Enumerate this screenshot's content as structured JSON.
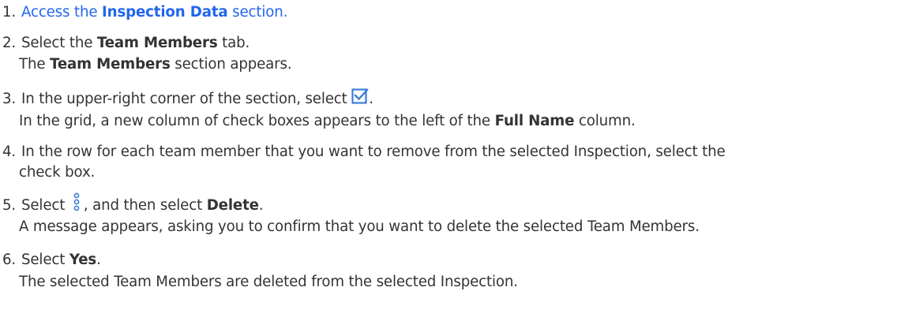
{
  "steps": [
    {
      "number": "1.",
      "text_before": "Access the ",
      "bold": "Inspection Data",
      "text_after": " section.",
      "is_link": true
    },
    {
      "number": "2.",
      "text_before": "Select the ",
      "bold": "Team Members",
      "text_after": " tab.",
      "result_before": "The ",
      "result_bold": "Team Members",
      "result_after": " section appears."
    },
    {
      "number": "3.",
      "text_before": "In the upper-right corner of the section, select ",
      "icon": "checkbox-select-icon",
      "text_after": ".",
      "result_before": "In the grid, a new column of check boxes appears to the left of the ",
      "result_bold": "Full Name",
      "result_after": " column."
    },
    {
      "number": "4.",
      "text_line1": "In the row for each team member that you want to remove from the selected Inspection, select the",
      "text_line2": "check box."
    },
    {
      "number": "5.",
      "text_before": "Select ",
      "icon": "more-options-vertical-icon",
      "text_middle": ", and then select ",
      "bold": "Delete",
      "text_after": ".",
      "result": "A message appears, asking you to confirm that you want to delete the selected Team Members."
    },
    {
      "number": "6.",
      "text_before": "Select ",
      "bold": "Yes",
      "text_after": ".",
      "result": "The selected Team Members are deleted from the selected Inspection."
    }
  ],
  "colors": {
    "text": "#333333",
    "link": "#2266ee",
    "icon_blue": "#3b7fd4"
  }
}
